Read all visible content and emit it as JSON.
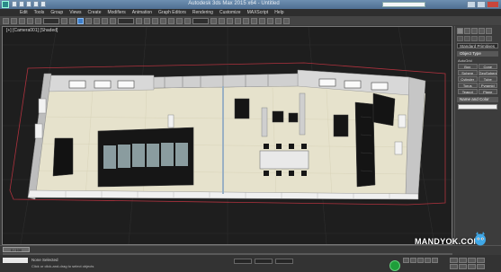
{
  "app": {
    "window_title": "Autodesk 3ds Max 2015 x64 - Untitled",
    "search_placeholder": ""
  },
  "menu": {
    "items": [
      "Edit",
      "Tools",
      "Group",
      "Views",
      "Create",
      "Modifiers",
      "Animation",
      "Graph Editors",
      "Rendering",
      "Customize",
      "MAXScript",
      "Help"
    ]
  },
  "viewport": {
    "label": "[+] [Camera001] [Shaded]"
  },
  "command_panel": {
    "selector": "Standard Primitives",
    "object_type_header": "Object Type",
    "autogrid_label": "AutoGrid",
    "buttons": [
      "Box",
      "Cone",
      "Sphere",
      "GeoSphere",
      "Cylinder",
      "Tube",
      "Torus",
      "Pyramid",
      "Teapot",
      "Plane"
    ],
    "name_color_header": "Name and Color"
  },
  "timeline": {
    "slider_label": "0 / 100"
  },
  "status": {
    "selection": "None Selected",
    "prompt": "Click or click-and-drag to select objects"
  },
  "watermark": {
    "text": "MANDYOK.COM"
  },
  "colors": {
    "accent_blue": "#3f7fc9",
    "autokey_green": "#1e9e3a",
    "viewport_bg": "#1e1e1e",
    "floor": "#e6e2cc"
  }
}
